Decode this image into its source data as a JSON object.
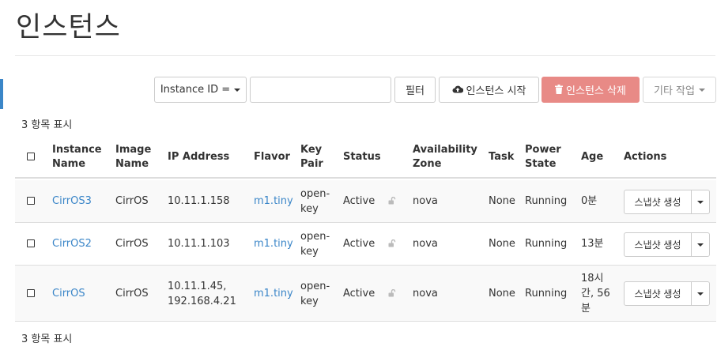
{
  "page": {
    "title": "인스턴스"
  },
  "toolbar": {
    "filter_field": "Instance ID =",
    "filter_value": "",
    "filter_button": "필터",
    "launch_button": "인스턴스 시작",
    "delete_button": "인스턴스 삭제",
    "more_actions": "기타 작업"
  },
  "summary": {
    "count_text": "3 항목 표시"
  },
  "table": {
    "columns": {
      "instance_name": [
        "Instance",
        "Name"
      ],
      "image_name": [
        "Image",
        "Name"
      ],
      "ip_address": "IP Address",
      "flavor": "Flavor",
      "key_pair": [
        "Key",
        "Pair"
      ],
      "status": "Status",
      "availability_zone": [
        "Availability",
        "Zone"
      ],
      "task": "Task",
      "power_state": [
        "Power",
        "State"
      ],
      "age": "Age",
      "actions": "Actions"
    },
    "rows": [
      {
        "name": "CirrOS3",
        "image": "CirrOS",
        "ip": [
          "10.11.1.158"
        ],
        "flavor": "m1.tiny",
        "key_pair": [
          "open-",
          "key"
        ],
        "status": "Active",
        "zone": "nova",
        "task": "None",
        "power": "Running",
        "age": [
          "0분"
        ],
        "action": "스냅샷 생성"
      },
      {
        "name": "CirrOS2",
        "image": "CirrOS",
        "ip": [
          "10.11.1.103"
        ],
        "flavor": "m1.tiny",
        "key_pair": [
          "open-",
          "key"
        ],
        "status": "Active",
        "zone": "nova",
        "task": "None",
        "power": "Running",
        "age": [
          "13분"
        ],
        "action": "스냅샷 생성"
      },
      {
        "name": "CirrOS",
        "image": "CirrOS",
        "ip": [
          "10.11.1.45,",
          "192.168.4.21"
        ],
        "flavor": "m1.tiny",
        "key_pair": [
          "open-",
          "key"
        ],
        "status": "Active",
        "zone": "nova",
        "task": "None",
        "power": "Running",
        "age": [
          "18시",
          "간, 56",
          "분"
        ],
        "action": "스냅샷 생성"
      }
    ]
  },
  "icons": {
    "launch": "cloud-upload-icon",
    "delete": "trash-icon",
    "lock": "unlock-icon",
    "caret": "caret-down-icon"
  },
  "colors": {
    "link": "#3b86c8",
    "danger": "#e88a86",
    "accent": "#3b86c8"
  }
}
